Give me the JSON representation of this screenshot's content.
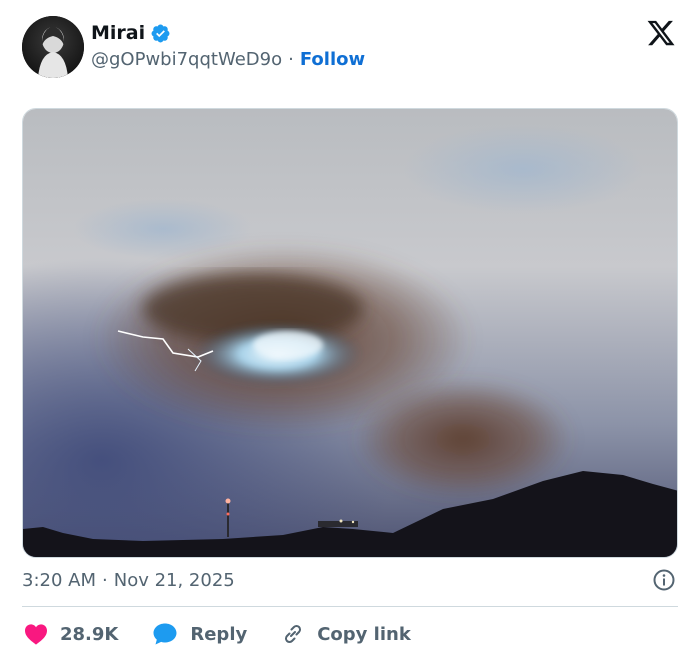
{
  "author": {
    "display_name": "Mirai",
    "handle": "@gOPwbi7qqtWeD9o",
    "separator": "·",
    "follow_label": "Follow"
  },
  "media": {
    "alt": ""
  },
  "meta": {
    "time": "3:20 AM",
    "separator": "·",
    "date": "Nov 21, 2025"
  },
  "actions": {
    "likes": "28.9K",
    "reply_label": "Reply",
    "copy_link_label": "Copy link"
  },
  "colors": {
    "like": "#f91880",
    "reply": "#1d9bf0",
    "follow": "#0f6fd4",
    "verified": "#1d9bf0",
    "muted_text": "#536471"
  },
  "icons": {
    "verified": "verified-badge-icon",
    "brand": "x-logo-icon",
    "info": "info-icon",
    "like": "heart-icon",
    "reply": "speech-bubble-icon",
    "copy": "link-icon"
  }
}
